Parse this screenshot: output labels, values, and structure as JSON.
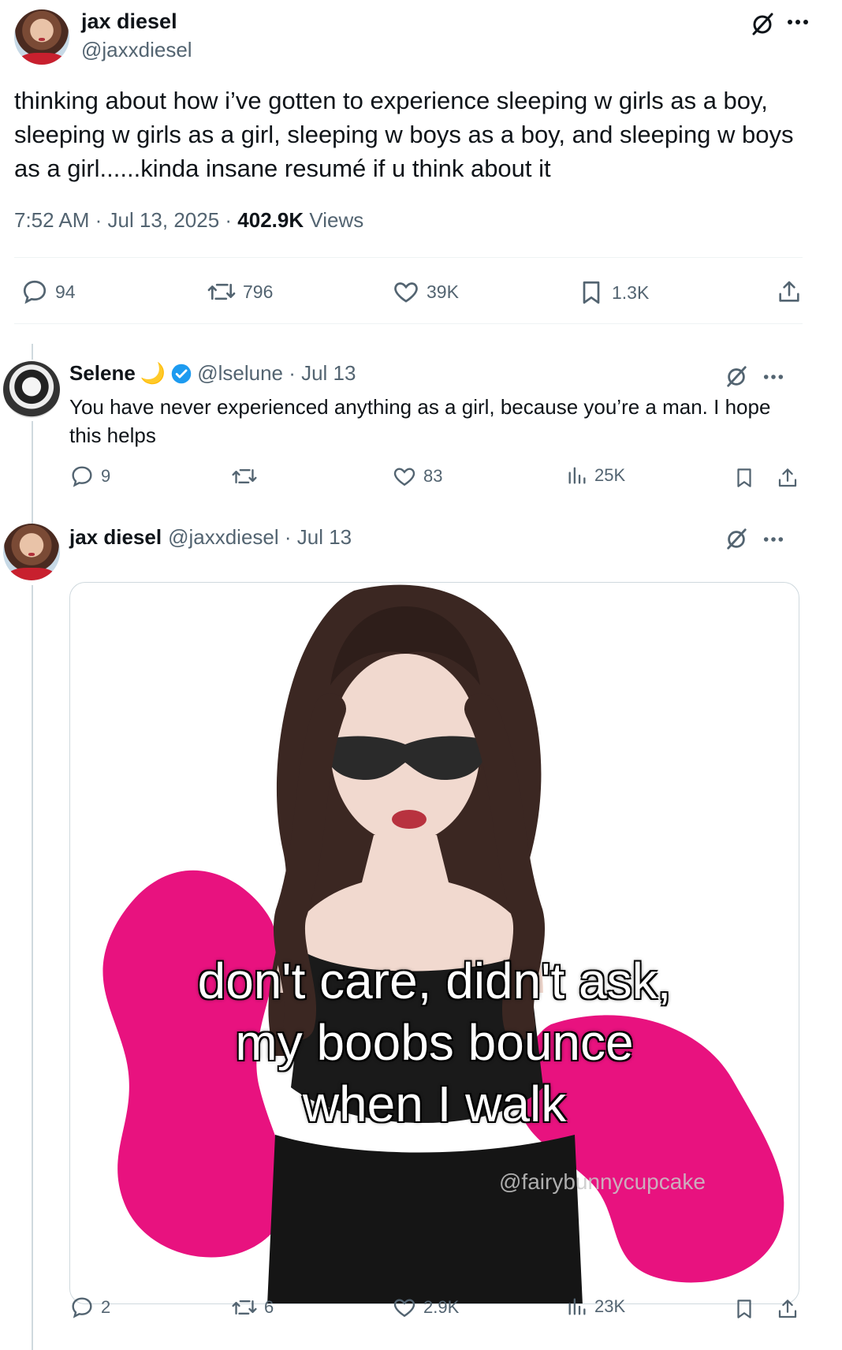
{
  "main_tweet": {
    "author_name": "jax diesel",
    "handle": "@jaxxdiesel",
    "text_line1": "thinking about how i’ve gotten to experience sleeping w girls as a boy,",
    "text_line2": "sleeping w girls as a girl, sleeping w boys as a boy, and sleeping w boys",
    "text_line3": "as a girl......kinda insane resumé if u think about it",
    "timestamp": "7:52 AM · Jul 13, 2025 · ",
    "views_count": "402.9K",
    "views_label": " Views",
    "replies": "94",
    "retweets": "796",
    "likes": "39K",
    "bookmarks": "1.3K"
  },
  "reply_selene": {
    "author_name": "Selene",
    "emoji": "🌙",
    "handle_date": "@lselune · Jul 13",
    "text_line1": "You have never experienced anything as a girl, because you’re a man. I hope",
    "text_line2": "this helps",
    "replies": "9",
    "retweets": "",
    "likes": "83",
    "views": "25K"
  },
  "reply_jax": {
    "author_name": "jax diesel",
    "handle_date": "@jaxxdiesel · Jul 13",
    "meme_line1": "don't care, didn't ask,",
    "meme_line2": "my boobs bounce",
    "meme_line3": "when I walk",
    "watermark": "@fairybunnycupcake",
    "replies": "2",
    "retweets": "6",
    "likes": "2.9K",
    "views": "23K"
  },
  "colors": {
    "text": "#0f1419",
    "muted": "#536471",
    "verified": "#1d9bf0",
    "divider": "#eff3f4",
    "fur_pink": "#e8127f"
  },
  "icons": [
    "grok-icon",
    "more-icon",
    "reply-icon",
    "retweet-icon",
    "like-icon",
    "bookmark-icon",
    "share-icon",
    "views-icon",
    "verified-badge-icon"
  ]
}
